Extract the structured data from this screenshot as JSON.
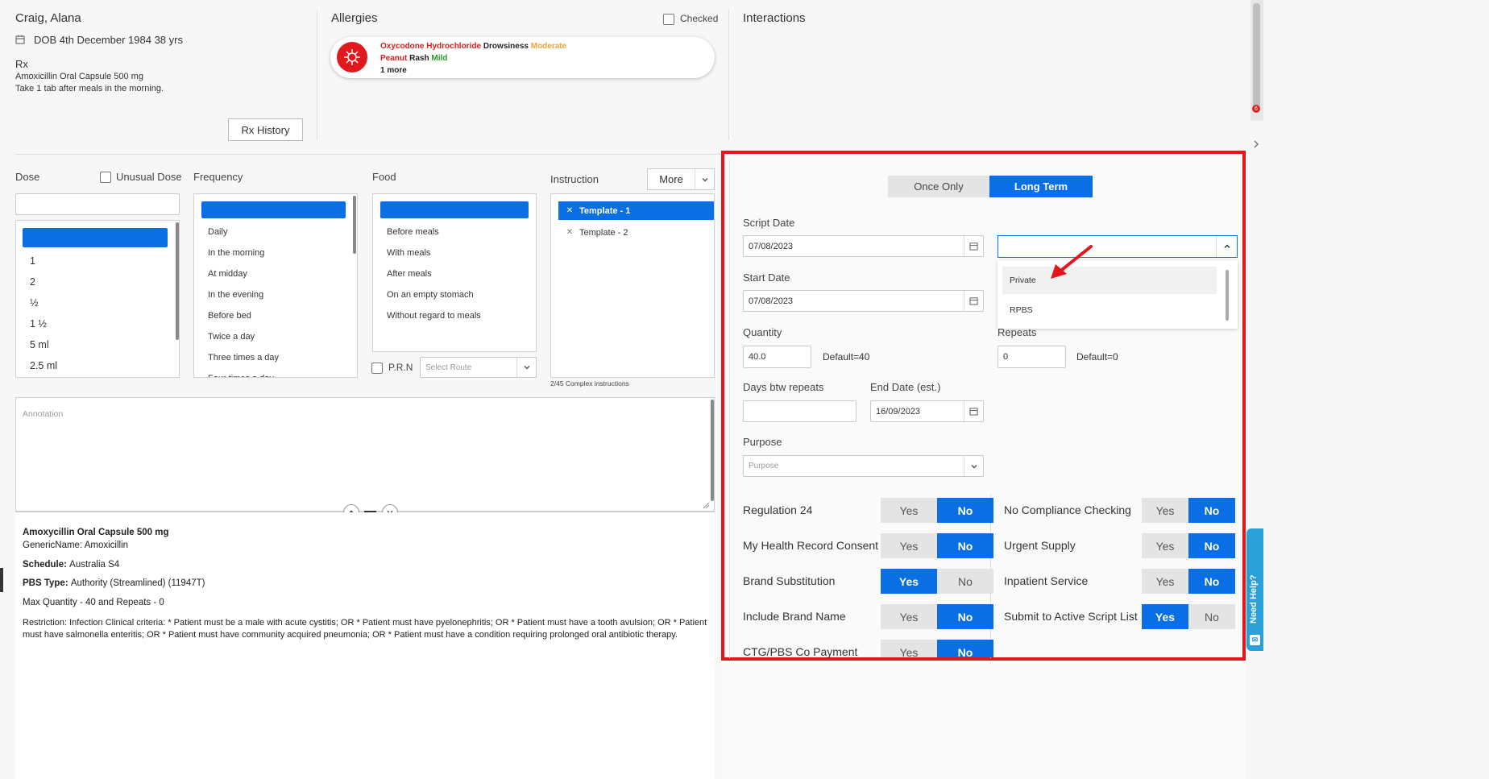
{
  "patient": {
    "name": "Craig, Alana",
    "dob": "DOB 4th December 1984 38 yrs",
    "rx_title": "Rx",
    "rx_drug": "Amoxicillin Oral Capsule 500 mg",
    "rx_instruction": "Take 1 tab after meals in the morning.",
    "rx_history_button": "Rx History"
  },
  "allergies": {
    "title": "Allergies",
    "checked_label": "Checked",
    "items": [
      {
        "name": "Oxycodone Hydrochloride",
        "reaction": "Drowsiness",
        "severity": "Moderate"
      },
      {
        "name": "Peanut",
        "reaction": "Rash",
        "severity": "Mild"
      }
    ],
    "more": "1 more",
    "colors": {
      "name": "#e0191f",
      "moderate": "#f0a030",
      "mild": "#2a9a2a"
    }
  },
  "interactions": {
    "title": "Interactions"
  },
  "dose": {
    "label": "Dose",
    "unusual_label": "Unusual Dose",
    "items": [
      "1",
      "2",
      "½",
      "1 ½",
      "5 ml",
      "2.5 ml"
    ]
  },
  "frequency": {
    "label": "Frequency",
    "items": [
      "Daily",
      "In the morning",
      "At midday",
      "In the evening",
      "Before bed",
      "Twice a day",
      "Three times a day",
      "Four times a day"
    ]
  },
  "food": {
    "label": "Food",
    "items": [
      "Before meals",
      "With meals",
      "After meals",
      "On an empty stomach",
      "Without regard to meals"
    ],
    "prn_label": "P.R.N",
    "route_placeholder": "Select Route"
  },
  "instruction": {
    "label": "Instruction",
    "more_button": "More",
    "templates": [
      "Template - 1",
      "Template - 2"
    ],
    "count": "2/45 Complex instructions"
  },
  "annotation": {
    "placeholder": "Annotation"
  },
  "drug_info": {
    "title": "Amoxycillin Oral Capsule 500 mg",
    "generic_label": "GenericName: ",
    "generic_value": "Amoxicillin",
    "schedule_label": "Schedule: ",
    "schedule_value": "Australia S4",
    "pbs_label": "PBS Type: ",
    "pbs_value": "Authority (Streamlined) (11947T)",
    "max_qty": "Max Quantity - 40 and Repeats - 0",
    "restriction": "Restriction: Infection Clinical criteria: * Patient must be a male with acute cystitis; OR * Patient must have pyelonephritis; OR * Patient must have a tooth avulsion; OR * Patient must have salmonella enteritis; OR * Patient must have community acquired pneumonia; OR * Patient must have a condition requiring prolonged oral antibiotic therapy."
  },
  "script": {
    "once_only": "Once Only",
    "long_term": "Long Term",
    "script_date_label": "Script Date",
    "script_date": "07/08/2023",
    "start_date_label": "Start Date",
    "start_date": "07/08/2023",
    "dropdown_options": [
      "Private",
      "RPBS"
    ],
    "quantity_label": "Quantity",
    "quantity": "40.0",
    "quantity_default": "Default=40",
    "repeats_label": "Repeats",
    "repeats": "0",
    "repeats_default": "Default=0",
    "days_btw_label": "Days btw repeats",
    "days_btw": "",
    "end_date_label": "End Date (est.)",
    "end_date": "16/09/2023",
    "purpose_label": "Purpose",
    "purpose_placeholder": "Purpose",
    "yes": "Yes",
    "no": "No",
    "left_toggles": [
      {
        "label": "Regulation 24",
        "value": "No"
      },
      {
        "label": "My Health Record Consent",
        "value": "No"
      },
      {
        "label": "Brand Substitution",
        "value": "Yes"
      },
      {
        "label": "Include Brand Name",
        "value": "No"
      },
      {
        "label": "CTG/PBS Co Payment",
        "value": "No"
      }
    ],
    "right_toggles": [
      {
        "label": "No Compliance Checking",
        "value": "No"
      },
      {
        "label": "Urgent Supply",
        "value": "No"
      },
      {
        "label": "Inpatient Service",
        "value": "No"
      },
      {
        "label": "Submit to Active Script List",
        "value": "Yes"
      }
    ]
  },
  "side": {
    "need_help": "Need Help?",
    "badge": "6"
  }
}
